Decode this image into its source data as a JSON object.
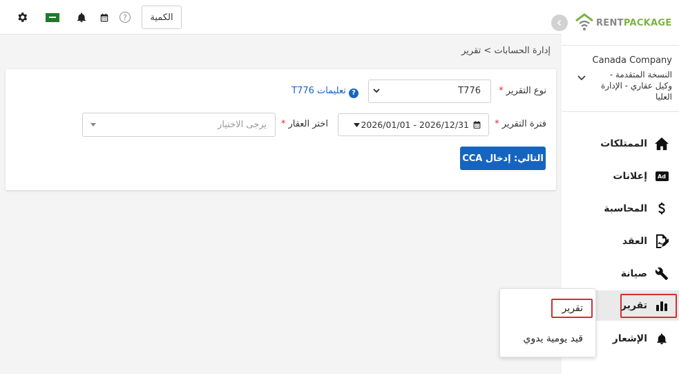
{
  "header": {
    "quantity_button": "الكمية",
    "help_glyph": "?"
  },
  "logo": {
    "rent": "RENT",
    "package": "PACKAGE"
  },
  "company": {
    "name": "Canada Company",
    "description": "النسخة المتقدمة - وكيل عقاري - الإدارة العليا"
  },
  "sidebar": {
    "items": [
      {
        "label": "الممتلكات",
        "icon": "home-icon"
      },
      {
        "label": "إعلانات",
        "icon": "ad-icon"
      },
      {
        "label": "المحاسبة",
        "icon": "dollar-icon"
      },
      {
        "label": "العقد",
        "icon": "contract-icon"
      },
      {
        "label": "صيانة",
        "icon": "wrench-icon"
      },
      {
        "label": "تقرير",
        "icon": "bar-chart-icon"
      },
      {
        "label": "الإشعار",
        "icon": "bell-icon"
      }
    ],
    "ad_badge": "Ad"
  },
  "breadcrumb": {
    "text": "إدارة الحسابات > تقرير"
  },
  "form": {
    "report_type_label": "نوع التقرير",
    "required_mark": "*",
    "report_type_value": "T776",
    "instructions_link": "تعليمات T776",
    "report_period_label": "فترة التقرير",
    "report_period_value": "2026/01/01 - 2026/12/31",
    "property_label": "اختر العقار",
    "property_placeholder": "يرجى الاختيار",
    "next_button": "التالي: إدخال CCA"
  },
  "submenu": {
    "items": [
      "تقرير",
      "قيد يومية يدوي"
    ]
  },
  "colors": {
    "accent": "#1565c0",
    "logo_green": "#7cb342",
    "highlight": "#d32f2f"
  }
}
